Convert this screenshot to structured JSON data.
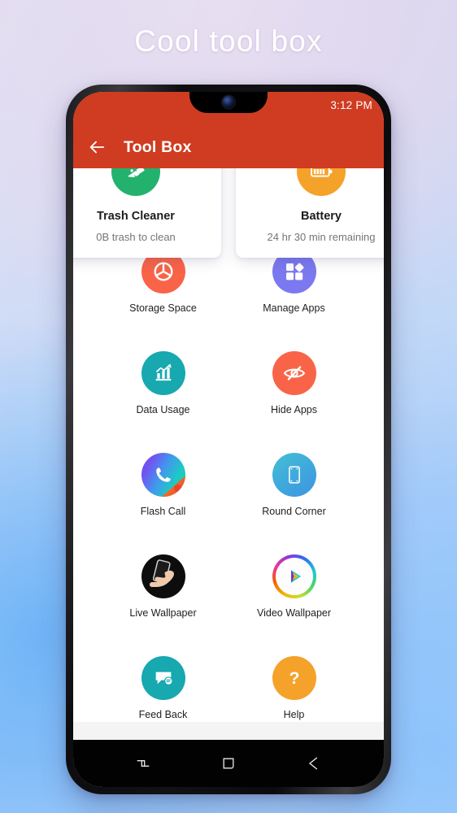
{
  "hero": {
    "title": "Cool tool box"
  },
  "status_bar": {
    "time": "3:12 PM"
  },
  "appbar": {
    "back_icon": "back-arrow-icon",
    "title": "Tool Box"
  },
  "feature_cards": [
    {
      "id": "trash-cleaner",
      "icon": "broom-icon",
      "icon_bg": "#23b26d",
      "title": "Trash Cleaner",
      "subtitle": "0B trash to clean"
    },
    {
      "id": "battery",
      "icon": "battery-icon",
      "icon_bg": "#f5a22a",
      "title": "Battery",
      "subtitle": "24 hr 30 min remaining"
    }
  ],
  "tools": [
    {
      "id": "storage-space",
      "icon": "pie-chart-icon",
      "icon_bg": "#f96448",
      "label": "Storage Space"
    },
    {
      "id": "manage-apps",
      "icon": "apps-grid-icon",
      "icon_bg": "#7b79ef",
      "label": "Manage Apps"
    },
    {
      "id": "data-usage",
      "icon": "bar-chart-icon",
      "icon_bg": "#17a8b0",
      "label": "Data Usage"
    },
    {
      "id": "hide-apps",
      "icon": "eye-slash-icon",
      "icon_bg": "#f96448",
      "label": "Hide Apps"
    },
    {
      "id": "flash-call",
      "icon": "phone-icon",
      "icon_bg": "#7d5cf0",
      "label": "Flash Call"
    },
    {
      "id": "round-corner",
      "icon": "phone-frame-icon",
      "icon_bg": "#3fa9dd",
      "label": "Round Corner"
    },
    {
      "id": "live-wallpaper",
      "icon": "hand-phone-icon",
      "icon_bg": "#111111",
      "label": "Live Wallpaper"
    },
    {
      "id": "video-wallpaper",
      "icon": "play-circle-icon",
      "icon_bg": "#ffffff",
      "label": "Video Wallpaper"
    },
    {
      "id": "feed-back",
      "icon": "chat-bubble-icon",
      "icon_bg": "#17a8b0",
      "label": "Feed Back"
    },
    {
      "id": "help",
      "icon": "question-mark-icon",
      "icon_bg": "#f5a22a",
      "label": "Help"
    }
  ],
  "nav_bar": {
    "recents_icon": "recents-icon",
    "home_icon": "home-square-icon",
    "back_icon": "back-arrow-icon"
  },
  "theme": {
    "appbar_color": "#cf3c21",
    "screen_bg": "#ffffff"
  }
}
